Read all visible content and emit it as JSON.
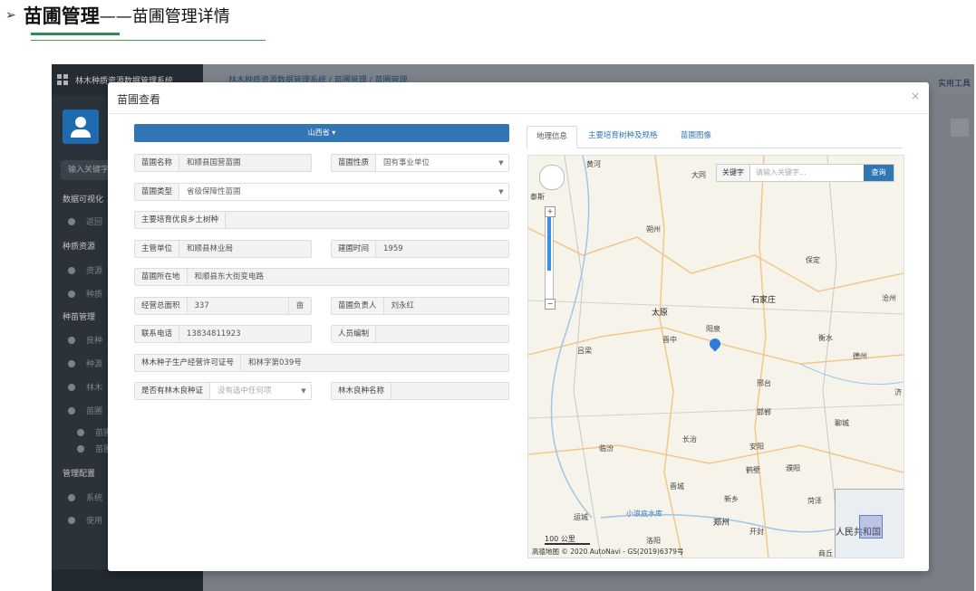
{
  "doc_heading": {
    "bullet": "➢",
    "main": "苗圃管理",
    "sub": "——苗圃管理详情"
  },
  "app": {
    "brand": "林木种质资源数据管理系统",
    "breadcrumb": "林木种质资源数据管理系统 / 苗圃管理 / 苗圃管理",
    "tools": "实用工具",
    "search_placeholder": "输入关键字",
    "sidebar": [
      {
        "section": "数据可视化"
      },
      {
        "item": "返回"
      },
      {
        "section": "种质资源"
      },
      {
        "item": "资源"
      },
      {
        "item": "种质"
      },
      {
        "section": "种苗管理"
      },
      {
        "item": "良种"
      },
      {
        "item": "种源"
      },
      {
        "item": "林木"
      },
      {
        "item": "苗圃"
      },
      {
        "item": "苗圃"
      },
      {
        "item": "苗圃"
      },
      {
        "section": "管理配置"
      },
      {
        "item": "系统"
      },
      {
        "item": "使用"
      }
    ]
  },
  "modal": {
    "title": "苗圃查看",
    "close": "×",
    "province_button": "山西省 ▾",
    "fields": {
      "name_label": "苗圃名称",
      "name": "和顺县国营苗圃",
      "nature_label": "苗圃性质",
      "nature": "国有事业单位",
      "type_label": "苗圃类型",
      "type": "省级保障性苗圃",
      "species_label": "主要培育优良乡土树种",
      "species": "",
      "unit_label": "主管单位",
      "unit": "和顺县林业局",
      "built_label": "建圃时间",
      "built": "1959",
      "location_label": "苗圃所在地",
      "location": "和顺县东大街变电路",
      "area_label": "经营总面积",
      "area": "337",
      "area_unit": "亩",
      "manager_label": "苗圃负责人",
      "manager": "刘永红",
      "phone_label": "联系电话",
      "phone": "13834811923",
      "staff_label": "人员编制",
      "staff": "",
      "license_label": "林木种子生产经营许可证号",
      "license": "和林字第039号",
      "has_cert_label": "是否有林木良种证",
      "has_cert": "没有选中任何项",
      "seed_name_label": "林木良种名称",
      "seed_name": ""
    },
    "tabs": [
      "地理信息",
      "主要培育树种及规格",
      "苗圃图像"
    ],
    "map": {
      "keyword_label": "关键字",
      "keyword_placeholder": "请输入关键字...",
      "search_button": "查询",
      "cities": [
        "大同",
        "朔州",
        "保定",
        "石家庄",
        "太原",
        "阳泉",
        "晋中",
        "吕梁",
        "衡水",
        "沧州",
        "德州",
        "邢台",
        "长治",
        "邯郸",
        "聊城",
        "临汾",
        "安阳",
        "鹤壁",
        "濮阳",
        "晋城",
        "新乡",
        "运城",
        "郑州",
        "开封",
        "洛阳",
        "菏泽",
        "商丘",
        "济",
        "小浪底水库",
        "黄河"
      ],
      "scale": "100 公里",
      "copyright": "高德地图 © 2020 AutoNavi - GS(2019)6379号",
      "minimap_text": "人民共和国",
      "side_label": "泰斯"
    }
  }
}
